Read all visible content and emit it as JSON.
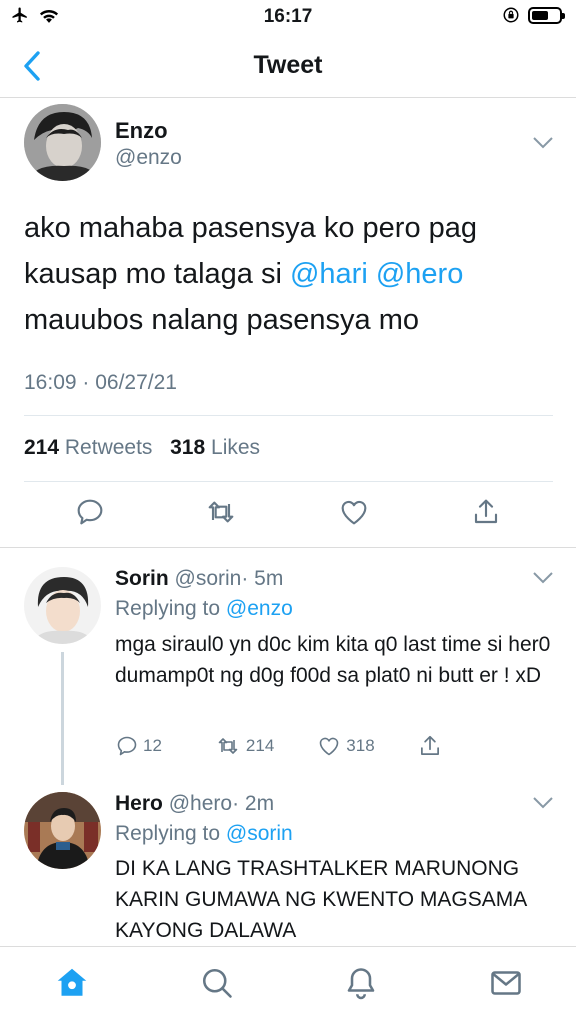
{
  "status_bar": {
    "time": "16:17",
    "icons": [
      "airplane-icon",
      "wifi-icon",
      "orientation-lock-icon",
      "battery-icon"
    ],
    "battery_level": 0.6
  },
  "nav": {
    "title": "Tweet",
    "back_icon": "chevron-left-icon"
  },
  "tweet": {
    "author_name": "Enzo",
    "author_handle": "@enzo",
    "text_before": "ako mahaba pasensya ko pero pag kausap mo talaga si ",
    "mention_1": "@hari",
    "mention_2": "@hero",
    "text_after": " mauubos nalang pasensya mo",
    "timestamp": "16:09 · 06/27/21",
    "retweet_count": "214",
    "retweets_label": "Retweets",
    "like_count": "318",
    "likes_label": "Likes",
    "actions": [
      "reply-icon",
      "retweet-icon",
      "like-icon",
      "share-icon"
    ]
  },
  "replies": [
    {
      "name": "Sorin",
      "handle": "@sorin",
      "time": "· 5m",
      "replying_prefix": "Replying to",
      "replying_to": "@enzo",
      "text": "mga siraul0 yn d0c kim kita q0 last time si her0 dumamp0t ng d0g f00d sa plat0 ni butt er ! xD",
      "reply_count": "12",
      "retweet_count": "214",
      "like_count": "318"
    },
    {
      "name": "Hero",
      "handle": "@hero",
      "time": "· 2m",
      "replying_prefix": "Replying to",
      "replying_to": "@sorin",
      "text": "DI KA LANG TRASHTALKER MARUNONG KARIN GUMAWA NG KWENTO MAGSAMA KAYONG DALAWA"
    }
  ],
  "tab_bar": {
    "tabs": [
      "home-icon",
      "search-icon",
      "notifications-icon",
      "messages-icon"
    ],
    "active_tab": "home-icon"
  },
  "colors": {
    "accent": "#1da1f2",
    "secondary_text": "#657786",
    "primary_text": "#14171a"
  }
}
